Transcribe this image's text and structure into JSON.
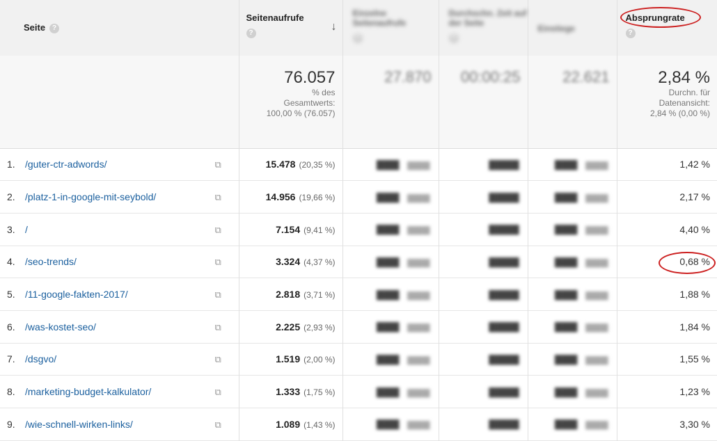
{
  "header": {
    "page_label": "Seite",
    "help_glyph": "?",
    "views_label": "Seitenaufrufe",
    "blurred_1": "Einzelne Seitenaufrufe",
    "blurred_2": "Durchschn. Zeit auf der Seite",
    "blurred_3": "Einstiege",
    "bounce_label": "Absprungrate",
    "sort_icon": "arrow-down-icon"
  },
  "totals": {
    "views_value": "76.057",
    "views_sub1": "% des",
    "views_sub2": "Gesamtwerts:",
    "views_sub3": "100,00 % (76.057)",
    "blur1_value": "27.870",
    "blur2_value": "00:00:25",
    "blur3_value": "22.621",
    "bounce_value": "2,84 %",
    "bounce_sub1": "Durchn. für",
    "bounce_sub2": "Datenansicht:",
    "bounce_sub3": "2,84 % (0,00 %)"
  },
  "rows": [
    {
      "num": "1.",
      "page": "/guter-ctr-adwords/",
      "views": "15.478",
      "pct": "(20,35 %)",
      "bounce": "1,42 %"
    },
    {
      "num": "2.",
      "page": "/platz-1-in-google-mit-seybold/",
      "views": "14.956",
      "pct": "(19,66 %)",
      "bounce": "2,17 %"
    },
    {
      "num": "3.",
      "page": "/",
      "views": "7.154",
      "pct": "(9,41 %)",
      "bounce": "4,40 %"
    },
    {
      "num": "4.",
      "page": "/seo-trends/",
      "views": "3.324",
      "pct": "(4,37 %)",
      "bounce": "0,68 %"
    },
    {
      "num": "5.",
      "page": "/11-google-fakten-2017/",
      "views": "2.818",
      "pct": "(3,71 %)",
      "bounce": "1,88 %"
    },
    {
      "num": "6.",
      "page": "/was-kostet-seo/",
      "views": "2.225",
      "pct": "(2,93 %)",
      "bounce": "1,84 %"
    },
    {
      "num": "7.",
      "page": "/dsgvo/",
      "views": "1.519",
      "pct": "(2,00 %)",
      "bounce": "1,55 %"
    },
    {
      "num": "8.",
      "page": "/marketing-budget-kalkulator/",
      "views": "1.333",
      "pct": "(1,75 %)",
      "bounce": "1,23 %"
    },
    {
      "num": "9.",
      "page": "/wie-schnell-wirken-links/",
      "views": "1.089",
      "pct": "(1,43 %)",
      "bounce": "3,30 %"
    }
  ],
  "colors": {
    "link": "#1a5f9e",
    "annotation": "#cc1f1f"
  }
}
